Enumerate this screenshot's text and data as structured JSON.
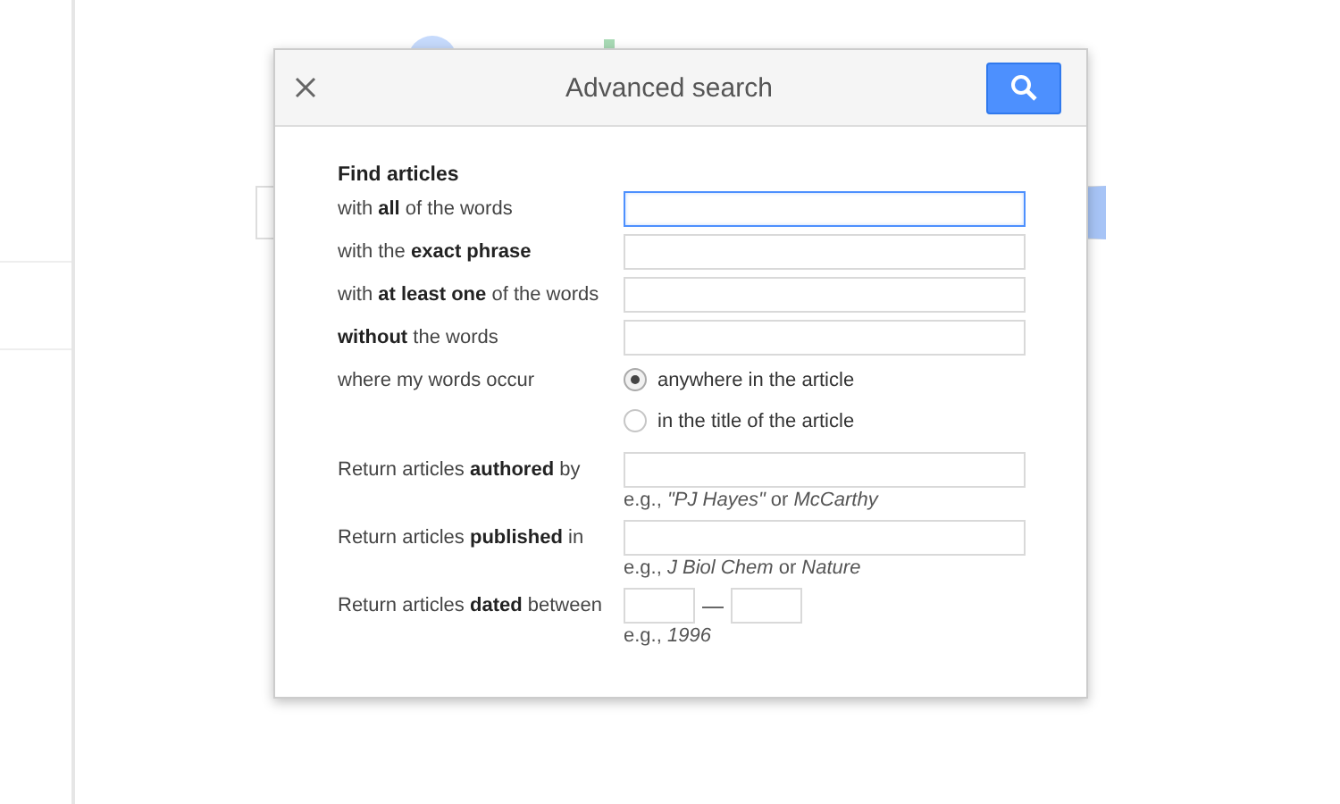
{
  "dialog": {
    "title": "Advanced search",
    "heading": "Find articles",
    "rows": [
      {
        "kind": "text",
        "label": "with **all** of the words",
        "focused": true
      },
      {
        "kind": "text",
        "label": "with the **exact phrase**",
        "focused": false
      },
      {
        "kind": "text",
        "label": "with **at least one** of the words",
        "focused": false
      },
      {
        "kind": "text",
        "label": "**without** the words",
        "focused": false
      },
      {
        "kind": "radio",
        "label": "where my words occur",
        "options": [
          {
            "label": "anywhere in the article",
            "selected": true
          },
          {
            "label": "in the title of the article",
            "selected": false
          }
        ]
      },
      {
        "kind": "text",
        "label": "Return articles **authored** by",
        "focused": false,
        "hint": "e.g., *\"PJ Hayes\"* or *McCarthy*"
      },
      {
        "kind": "text",
        "label": "Return articles **published** in",
        "focused": false,
        "hint": "e.g., *J Biol Chem* or *Nature*"
      },
      {
        "kind": "date",
        "label": "Return articles **dated** between",
        "separator": "—",
        "hint": "e.g., *1996*"
      }
    ]
  }
}
